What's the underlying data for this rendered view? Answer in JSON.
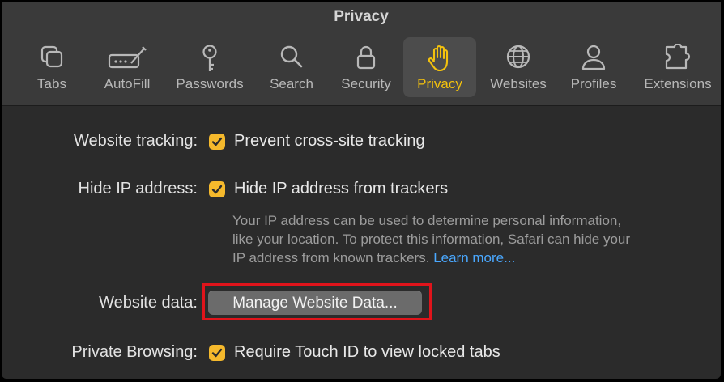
{
  "window": {
    "title": "Privacy"
  },
  "tabs": [
    {
      "key": "tabs",
      "label": "Tabs",
      "icon": "tabs-icon"
    },
    {
      "key": "autofill",
      "label": "AutoFill",
      "icon": "autofill-icon"
    },
    {
      "key": "passwords",
      "label": "Passwords",
      "icon": "key-icon"
    },
    {
      "key": "search",
      "label": "Search",
      "icon": "search-icon"
    },
    {
      "key": "security",
      "label": "Security",
      "icon": "lock-icon"
    },
    {
      "key": "privacy",
      "label": "Privacy",
      "icon": "hand-icon",
      "active": true
    },
    {
      "key": "websites",
      "label": "Websites",
      "icon": "globe-icon"
    },
    {
      "key": "profiles",
      "label": "Profiles",
      "icon": "person-icon"
    },
    {
      "key": "extensions",
      "label": "Extensions",
      "icon": "puzzle-icon"
    }
  ],
  "settings": {
    "website_tracking": {
      "label": "Website tracking:",
      "option": "Prevent cross-site tracking",
      "checked": true
    },
    "hide_ip": {
      "label": "Hide IP address:",
      "option": "Hide IP address from trackers",
      "checked": true,
      "description_line1": "Your IP address can be used to determine personal information,",
      "description_line2": "like your location. To protect this information, Safari can hide your",
      "description_line3": "IP address from known trackers.",
      "learn_more": "Learn more..."
    },
    "website_data": {
      "label": "Website data:",
      "button": "Manage Website Data..."
    },
    "private_browsing": {
      "label": "Private Browsing:",
      "option": "Require Touch ID to view locked tabs",
      "checked": true
    }
  },
  "colors": {
    "accent": "#f4c20d",
    "checkbox": "#f5b92c",
    "link": "#4aa8ff",
    "highlight_outline": "#e0141b"
  }
}
